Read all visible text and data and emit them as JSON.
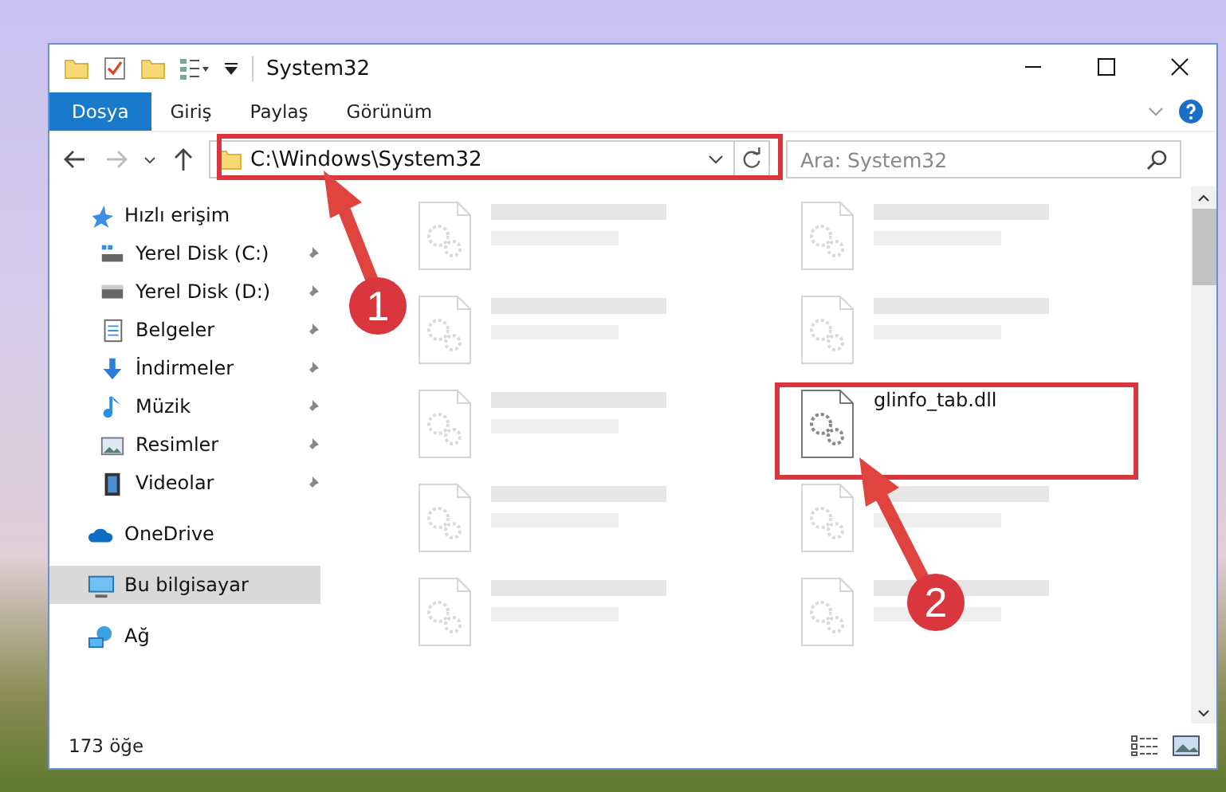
{
  "window": {
    "title": "System32"
  },
  "ribbon_tabs": [
    {
      "label": "Dosya",
      "selected": true
    },
    {
      "label": "Giriş",
      "selected": false
    },
    {
      "label": "Paylaş",
      "selected": false
    },
    {
      "label": "Görünüm",
      "selected": false
    }
  ],
  "address": {
    "path": "C:\\Windows\\System32"
  },
  "search": {
    "placeholder": "Ara: System32"
  },
  "sidebar": {
    "items": [
      {
        "label": "Hızlı erişim",
        "kind": "star",
        "selected": false,
        "children": [
          {
            "label": "Yerel Disk (C:)",
            "kind": "drive-c",
            "pinned": true,
            "selected": false
          },
          {
            "label": "Yerel Disk (D:)",
            "kind": "drive",
            "pinned": true,
            "selected": false
          },
          {
            "label": "Belgeler",
            "kind": "doc",
            "pinned": true,
            "selected": false
          },
          {
            "label": "İndirmeler",
            "kind": "download",
            "pinned": true,
            "selected": false
          },
          {
            "label": "Müzik",
            "kind": "music",
            "pinned": true,
            "selected": false
          },
          {
            "label": "Resimler",
            "kind": "picture",
            "pinned": true,
            "selected": false
          },
          {
            "label": "Videolar",
            "kind": "video",
            "pinned": true,
            "selected": false
          }
        ]
      },
      {
        "label": "OneDrive",
        "kind": "cloud",
        "selected": false
      },
      {
        "label": "Bu bilgisayar",
        "kind": "computer",
        "selected": true
      },
      {
        "label": "Ağ",
        "kind": "network",
        "selected": false
      }
    ]
  },
  "files": [
    {
      "blurred": true
    },
    {
      "blurred": true
    },
    {
      "blurred": true
    },
    {
      "blurred": true
    },
    {
      "blurred": true
    },
    {
      "name": "glinfo_tab.dll",
      "blurred": false
    },
    {
      "blurred": true
    },
    {
      "blurred": true
    },
    {
      "blurred": true
    },
    {
      "blurred": true
    }
  ],
  "status_bar": {
    "count": "173 öğe"
  },
  "annotations": [
    {
      "number": "1"
    },
    {
      "number": "2"
    }
  ]
}
